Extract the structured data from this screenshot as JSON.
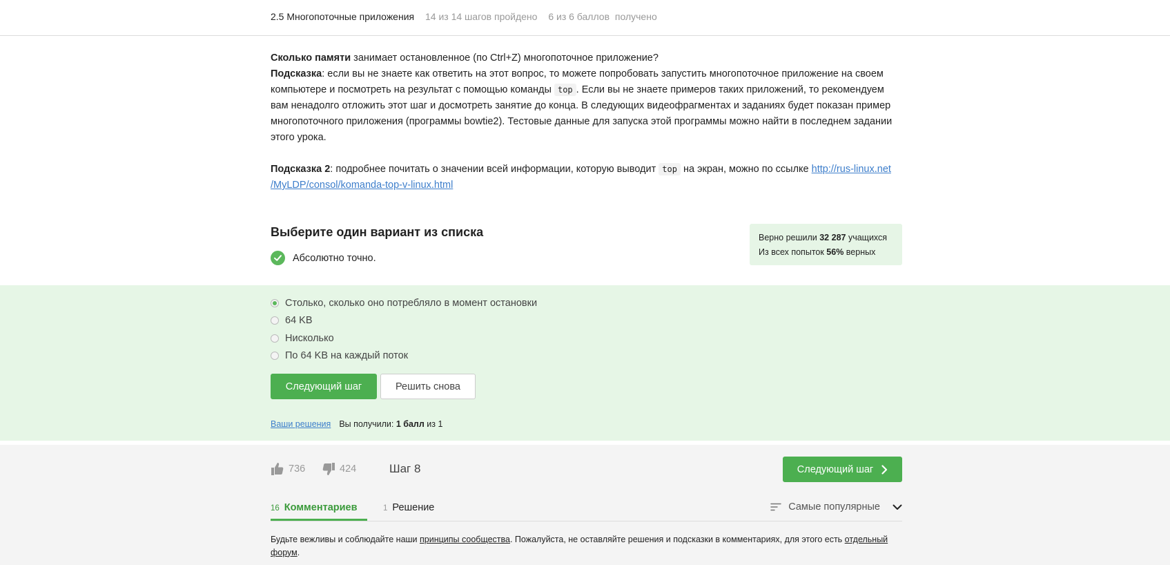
{
  "header": {
    "title": "2.5 Многопоточные приложения",
    "progress": "14 из 14 шагов пройдено",
    "score": "6 из 6 баллов",
    "score_suffix": "получено"
  },
  "question": {
    "q_bold": "Сколько памяти",
    "q_text": " занимает остановленное (по Ctrl+Z) многопоточное приложение?",
    "hint1_label": "Подсказка",
    "hint1_text_a": ": если вы не знаете как ответить на этот вопрос, то можете попробовать запустить многопоточное приложение на своем компьютере и посмотреть на результат с помощью команды ",
    "hint1_code": "top",
    "hint1_text_b": ". Если вы не знаете примеров таких приложений, то рекомендуем вам ненадолго отложить этот шаг и досмотреть занятие до конца. В следующих видеофрагментах и заданиях будет показан пример многопоточного приложения (программы bowtie2). Тестовые данные для запуска этой программы можно найти в последнем задании этого урока.",
    "hint2_label": "Подсказка 2",
    "hint2_text_a": ": подробнее почитать о значении всей информации, которую выводит ",
    "hint2_code": "top",
    "hint2_text_b": " на экран, можно по ссылке ",
    "hint2_link_a": "http://rus-linux.net",
    "hint2_link_b": "/MyLDP/consol/komanda-top-v-linux.html"
  },
  "choice": {
    "title": "Выберите один вариант из списка",
    "correct_text": "Абсолютно точно.",
    "stats_line1_a": "Верно решили ",
    "stats_line1_num": "32 287",
    "stats_line1_b": " учащихся",
    "stats_line2_a": "Из всех попыток ",
    "stats_line2_num": "56%",
    "stats_line2_b": " верных",
    "options": [
      "Столько, сколько оно потребляло в момент остановки",
      "64 KB",
      "Нисколько",
      "По 64 KB на каждый поток"
    ],
    "selected_index": 0,
    "next_label": "Следующий шаг",
    "retry_label": "Решить снова",
    "solutions_link": "Ваши решения",
    "result_a": "Вы получили: ",
    "result_bold": "1 балл",
    "result_b": " из 1"
  },
  "footer": {
    "likes": "736",
    "dislikes": "424",
    "step": "Шаг 8",
    "next_label": "Следующий шаг",
    "tabs": [
      {
        "count": "16",
        "label": "Комментариев"
      },
      {
        "count": "1",
        "label": "Решение"
      }
    ],
    "sort_label": "Самые популярные",
    "rules_a": "Будьте вежливы и соблюдайте наши ",
    "rules_link1": "принципы сообщества",
    "rules_b": ". Пожалуйста, не оставляйте решения и подсказки в комментариях, для этого есть ",
    "rules_link2": "отдельный форум",
    "rules_c": "."
  },
  "colors": {
    "accent_green": "#4caf50",
    "band_green": "#e6f6e6",
    "link_blue": "#3d7ecb"
  }
}
